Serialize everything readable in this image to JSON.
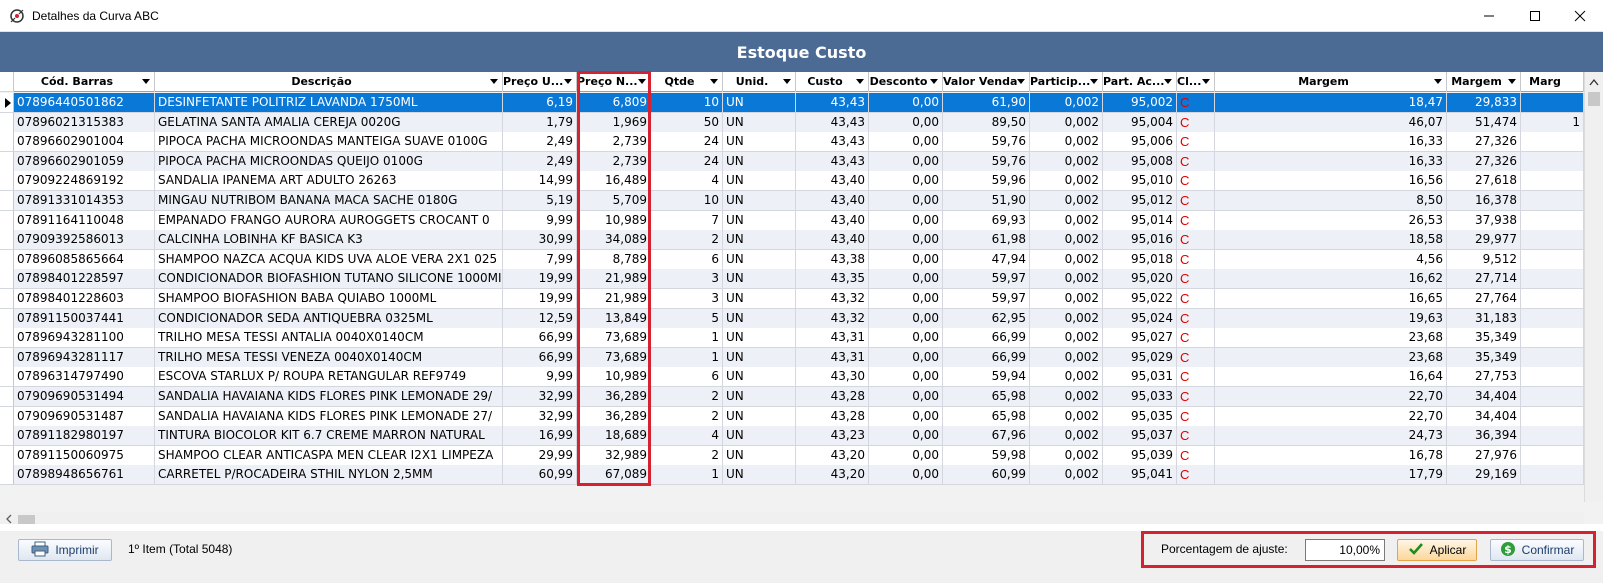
{
  "window": {
    "title": "Detalhes da Curva ABC"
  },
  "grid": {
    "title": "Estoque Custo",
    "columns": [
      {
        "label": "Cód. Barras",
        "dd": true
      },
      {
        "label": "Descrição",
        "dd": true
      },
      {
        "label": "Preço U...",
        "dd": true
      },
      {
        "label": "Preço N...",
        "dd": true
      },
      {
        "label": "Qtde",
        "dd": true
      },
      {
        "label": "Unid.",
        "dd": true
      },
      {
        "label": "Custo",
        "dd": true
      },
      {
        "label": "Desconto",
        "dd": true
      },
      {
        "label": "Valor Venda",
        "dd": true
      },
      {
        "label": "Particip...",
        "dd": true
      },
      {
        "label": "Part. Ac...",
        "dd": true
      },
      {
        "label": "Cl...",
        "dd": true
      },
      {
        "label": "Margem",
        "dd": true
      },
      {
        "label": "Margem",
        "dd": true
      },
      {
        "label": "Marg",
        "dd": false
      }
    ],
    "rows": [
      [
        "07896440501862",
        "DESINFETANTE POLITRIZ LAVANDA 1750ML",
        "6,19",
        "6,809",
        "10",
        "UN",
        "43,43",
        "0,00",
        "61,90",
        "0,002",
        "95,002",
        "C",
        "18,47",
        "29,833",
        ""
      ],
      [
        "07896021315383",
        "GELATINA SANTA AMALIA CEREJA 0020G",
        "1,79",
        "1,969",
        "50",
        "UN",
        "43,43",
        "0,00",
        "89,50",
        "0,002",
        "95,004",
        "C",
        "46,07",
        "51,474",
        "1"
      ],
      [
        "07896602901004",
        "PIPOCA PACHA MICROONDAS MANTEIGA SUAVE 0100G",
        "2,49",
        "2,739",
        "24",
        "UN",
        "43,43",
        "0,00",
        "59,76",
        "0,002",
        "95,006",
        "C",
        "16,33",
        "27,326",
        ""
      ],
      [
        "07896602901059",
        "PIPOCA PACHA MICROONDAS QUEIJO 0100G",
        "2,49",
        "2,739",
        "24",
        "UN",
        "43,43",
        "0,00",
        "59,76",
        "0,002",
        "95,008",
        "C",
        "16,33",
        "27,326",
        ""
      ],
      [
        "07909224869192",
        "SANDALIA IPANEMA ART ADULTO 26263",
        "14,99",
        "16,489",
        "4",
        "UN",
        "43,40",
        "0,00",
        "59,96",
        "0,002",
        "95,010",
        "C",
        "16,56",
        "27,618",
        ""
      ],
      [
        "07891331014353",
        "MINGAU NUTRIBOM BANANA MACA SACHE 0180G",
        "5,19",
        "5,709",
        "10",
        "UN",
        "43,40",
        "0,00",
        "51,90",
        "0,002",
        "95,012",
        "C",
        "8,50",
        "16,378",
        ""
      ],
      [
        "07891164110048",
        "EMPANADO FRANGO AURORA AUROGGETS CROCANT 0",
        "9,99",
        "10,989",
        "7",
        "UN",
        "43,40",
        "0,00",
        "69,93",
        "0,002",
        "95,014",
        "C",
        "26,53",
        "37,938",
        ""
      ],
      [
        "07909392586013",
        "CALCINHA LOBINHA KF BASICA K3",
        "30,99",
        "34,089",
        "2",
        "UN",
        "43,40",
        "0,00",
        "61,98",
        "0,002",
        "95,016",
        "C",
        "18,58",
        "29,977",
        ""
      ],
      [
        "07896085865664",
        "SHAMPOO NAZCA ACQUA KIDS UVA ALOE VERA 2X1 025",
        "7,99",
        "8,789",
        "6",
        "UN",
        "43,38",
        "0,00",
        "47,94",
        "0,002",
        "95,018",
        "C",
        "4,56",
        "9,512",
        ""
      ],
      [
        "07898401228597",
        "CONDICIONADOR BIOFASHION TUTANO SILICONE 1000MI",
        "19,99",
        "21,989",
        "3",
        "UN",
        "43,35",
        "0,00",
        "59,97",
        "0,002",
        "95,020",
        "C",
        "16,62",
        "27,714",
        ""
      ],
      [
        "07898401228603",
        "SHAMPOO BIOFASHION BABA QUIABO 1000ML",
        "19,99",
        "21,989",
        "3",
        "UN",
        "43,32",
        "0,00",
        "59,97",
        "0,002",
        "95,022",
        "C",
        "16,65",
        "27,764",
        ""
      ],
      [
        "07891150037441",
        "CONDICIONADOR SEDA ANTIQUEBRA 0325ML",
        "12,59",
        "13,849",
        "5",
        "UN",
        "43,32",
        "0,00",
        "62,95",
        "0,002",
        "95,024",
        "C",
        "19,63",
        "31,183",
        ""
      ],
      [
        "07896943281100",
        "TRILHO MESA TESSI ANTALIA 0040X0140CM",
        "66,99",
        "73,689",
        "1",
        "UN",
        "43,31",
        "0,00",
        "66,99",
        "0,002",
        "95,027",
        "C",
        "23,68",
        "35,349",
        ""
      ],
      [
        "07896943281117",
        "TRILHO MESA TESSI VENEZA 0040X0140CM",
        "66,99",
        "73,689",
        "1",
        "UN",
        "43,31",
        "0,00",
        "66,99",
        "0,002",
        "95,029",
        "C",
        "23,68",
        "35,349",
        ""
      ],
      [
        "07896314797490",
        "ESCOVA STARLUX P/ ROUPA RETANGULAR REF9749",
        "9,99",
        "10,989",
        "6",
        "UN",
        "43,30",
        "0,00",
        "59,94",
        "0,002",
        "95,031",
        "C",
        "16,64",
        "27,753",
        ""
      ],
      [
        "07909690531494",
        "SANDALIA HAVAIANA KIDS FLORES PINK LEMONADE 29/",
        "32,99",
        "36,289",
        "2",
        "UN",
        "43,28",
        "0,00",
        "65,98",
        "0,002",
        "95,033",
        "C",
        "22,70",
        "34,404",
        ""
      ],
      [
        "07909690531487",
        "SANDALIA HAVAIANA KIDS FLORES PINK LEMONADE 27/",
        "32,99",
        "36,289",
        "2",
        "UN",
        "43,28",
        "0,00",
        "65,98",
        "0,002",
        "95,035",
        "C",
        "22,70",
        "34,404",
        ""
      ],
      [
        "07891182980197",
        "TINTURA BIOCOLOR KIT 6.7 CREME MARRON NATURAL",
        "16,99",
        "18,689",
        "4",
        "UN",
        "43,23",
        "0,00",
        "67,96",
        "0,002",
        "95,037",
        "C",
        "24,73",
        "36,394",
        ""
      ],
      [
        "07891150060975",
        "SHAMPOO CLEAR ANTICASPA MEN CLEAR I2X1 LIMPEZA",
        "29,99",
        "32,989",
        "2",
        "UN",
        "43,20",
        "0,00",
        "59,98",
        "0,002",
        "95,039",
        "C",
        "16,78",
        "27,976",
        ""
      ],
      [
        "07898948656761",
        "CARRETEL P/ROCADEIRA STHIL NYLON 2,5MM",
        "60,99",
        "67,089",
        "1",
        "UN",
        "43,20",
        "0,00",
        "60,99",
        "0,002",
        "95,041",
        "C",
        "17,79",
        "29,169",
        ""
      ]
    ]
  },
  "footer": {
    "print_label": "Imprimir",
    "status": "1º Item (Total 5048)",
    "adjust_label": "Porcentagem de ajuste:",
    "adjust_value": "10,00%",
    "apply_label": "Aplicar",
    "confirm_label": "Confirmar"
  },
  "colors": {
    "header_bar": "#4b6b95",
    "selected_row": "#0a78d7",
    "highlight_border": "#d42231",
    "class_text": "#e00000"
  },
  "icons": {
    "app": "app-icon",
    "print": "printer-icon",
    "apply": "checkmark-icon",
    "confirm": "dollar-icon"
  }
}
